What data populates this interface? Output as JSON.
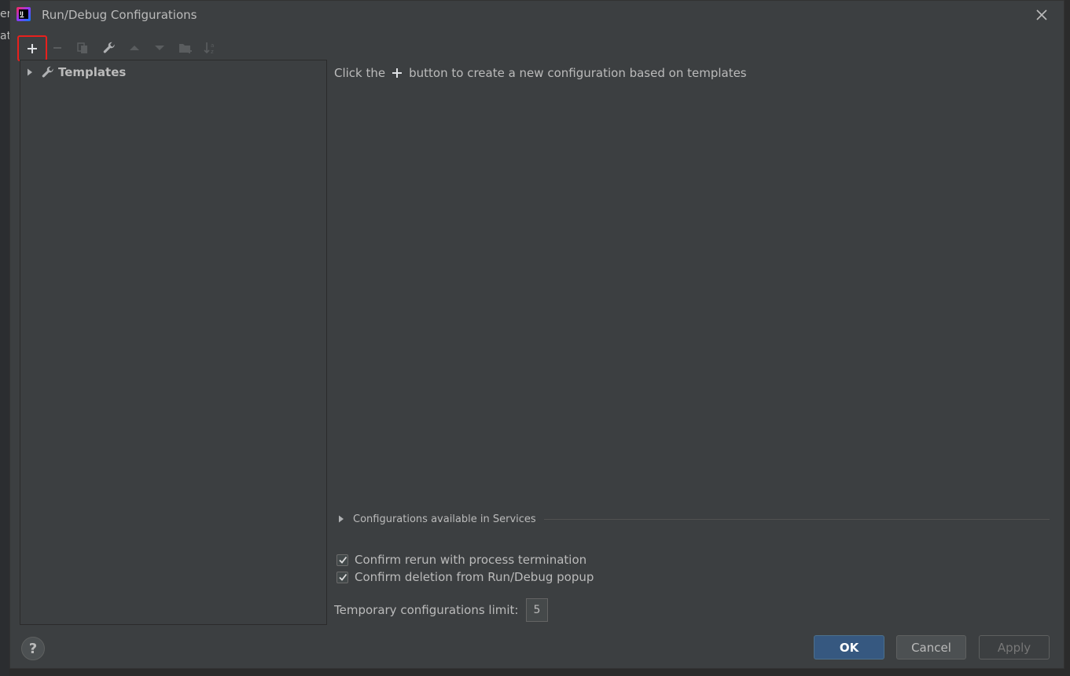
{
  "background": {
    "fragments": [
      "er",
      "at"
    ]
  },
  "dialog": {
    "title": "Run/Debug Configurations",
    "app_icon": "intellij-idea-icon",
    "close_icon": "close-icon"
  },
  "toolbar": {
    "buttons": [
      {
        "name": "add-button",
        "icon": "plus-icon",
        "enabled": true,
        "highlighted": true
      },
      {
        "name": "remove-button",
        "icon": "minus-icon",
        "enabled": false
      },
      {
        "name": "copy-button",
        "icon": "copy-icon",
        "enabled": false
      },
      {
        "name": "edit-templates-button",
        "icon": "wrench-icon",
        "enabled": true
      },
      {
        "name": "move-up-button",
        "icon": "arrow-up-icon",
        "enabled": false
      },
      {
        "name": "move-down-button",
        "icon": "arrow-down-icon",
        "enabled": false
      },
      {
        "name": "new-folder-button",
        "icon": "folder-add-icon",
        "enabled": false
      },
      {
        "name": "sort-button",
        "icon": "sort-alpha-icon",
        "enabled": false
      }
    ]
  },
  "tree": {
    "items": [
      {
        "label": "Templates",
        "icon": "wrench-icon",
        "expanded": false
      }
    ]
  },
  "main": {
    "hint_prefix": "Click the",
    "hint_suffix": "button to create a new configuration based on templates",
    "services_label": "Configurations available in Services",
    "confirm_rerun_label": "Confirm rerun with process termination",
    "confirm_rerun_checked": true,
    "confirm_deletion_label": "Confirm deletion from Run/Debug popup",
    "confirm_deletion_checked": true,
    "temp_limit_label": "Temporary configurations limit:",
    "temp_limit_value": "5"
  },
  "footer": {
    "help_label": "?",
    "ok_label": "OK",
    "cancel_label": "Cancel",
    "apply_label": "Apply"
  },
  "colors": {
    "dialog_bg": "#3c3f41",
    "text": "#bbbbbb",
    "ok_button": "#365880",
    "highlight_box": "#e8201d",
    "intellij_accent": "#fe2857"
  }
}
